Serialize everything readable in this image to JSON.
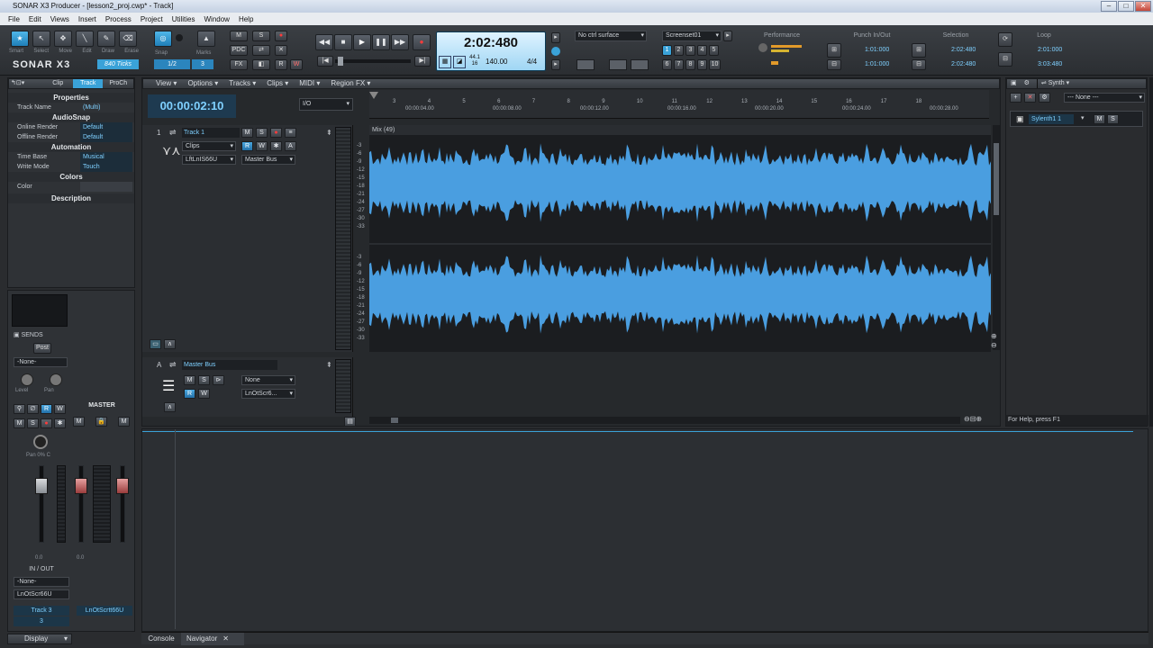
{
  "window": {
    "title": "SONAR X3 Producer - [lesson2_proj.cwp* - Track]"
  },
  "menu": [
    "File",
    "Edit",
    "Views",
    "Insert",
    "Process",
    "Project",
    "Utilities",
    "Window",
    "Help"
  ],
  "toolbar": {
    "tools": [
      "Smart",
      "Select",
      "Move",
      "Edit",
      "Draw",
      "Erase"
    ],
    "logo": "SONAR X3",
    "ticks": "840 Ticks",
    "snap": "Snap",
    "marks": "Marks",
    "snap_val": "1/2",
    "snap_num": "3",
    "mix_buttons": [
      "M",
      "S",
      "",
      "PDC",
      "",
      "FX",
      "",
      "",
      "R"
    ],
    "transport_time": "2:02:480",
    "sample_rate_top": "44.1",
    "sample_rate_bot": "16",
    "tempo": "140.00",
    "meter": "4/4",
    "ctrl_surface": "No ctrl surface",
    "screenset": "Screenset01",
    "screenset_nums": [
      "1",
      "2",
      "3",
      "4",
      "5",
      "6",
      "7",
      "8",
      "9",
      "10"
    ],
    "performance": "Performance",
    "punch": "Punch In/Out",
    "punch_in": "1:01:000",
    "punch_out": "1:01:000",
    "selection": "Selection",
    "sel_start": "2:02:480",
    "sel_end": "2:02:480",
    "loop": "Loop",
    "loop_start": "2:01:000",
    "loop_end": "3:03:480"
  },
  "inspector": {
    "tabs": [
      "Clip",
      "Track",
      "ProCh"
    ],
    "properties": "Properties",
    "track_name_label": "Track Name",
    "track_name_value": "(Multi)",
    "audiosnap": "AudioSnap",
    "online_render": "Online Render",
    "online_value": "Default",
    "offline_render": "Offline Render",
    "offline_value": "Default",
    "automation": "Automation",
    "time_base": "Time Base",
    "time_base_value": "Musical",
    "write_mode": "Write Mode",
    "write_mode_value": "Touch",
    "colors_sec": "Colors",
    "color_label": "Color",
    "description": "Description"
  },
  "strip": {
    "sends": "SENDS",
    "post": "Post",
    "none": "-None-",
    "level": "Level",
    "pan_label": "Pan",
    "master": "MASTER",
    "pan_val": "Pan 0% C",
    "db1": "0.0",
    "db2": "0.0",
    "inout": "IN / OUT",
    "input": "-None-",
    "output": "LnOtScr66U",
    "track_name": "Track 3",
    "track_num": "3",
    "master_out": "LnOtScrtt66U",
    "display": "Display"
  },
  "trackview": {
    "menus": [
      "View",
      "Options",
      "Tracks",
      "Clips",
      "MIDI",
      "Region FX"
    ],
    "time": "00:00:02:10",
    "io": "I/O",
    "track1_num": "1",
    "track1_name": "Track 1",
    "track1_clips": "Clips",
    "track1_in": "LftLnIS66U",
    "track1_out": "Master Bus",
    "clip_label": "Mix (49)",
    "bus_letter": "A",
    "bus_name": "Master Bus",
    "bus_none": "None",
    "bus_out": "LnOtScr6...",
    "ruler_bars": [
      "3",
      "4",
      "5",
      "6",
      "7",
      "8",
      "9",
      "10",
      "11",
      "12",
      "13",
      "14",
      "15",
      "16",
      "17",
      "18"
    ],
    "ruler_times": [
      "00:00:04.00",
      "00:00:08.00",
      "00:00:12.00",
      "00:00:16.00",
      "00:00:20.00",
      "00:00:24.00",
      "00:00:28.00"
    ],
    "db_scale": [
      "-3",
      "-6",
      "-9",
      "-12",
      "-15",
      "-18",
      "-21",
      "-24",
      "-27",
      "-30",
      "-33"
    ]
  },
  "browser": {
    "synth": "Synth",
    "none": "--- None ---",
    "instrument": "Sylenth1 1",
    "status": "For Help, press F1"
  },
  "bottom": {
    "tabs": [
      "Console",
      "Navigator"
    ]
  },
  "colors": {
    "accent": "#4ab4e8",
    "wave": "#4a9ee0",
    "rec": "#e53a3a"
  }
}
